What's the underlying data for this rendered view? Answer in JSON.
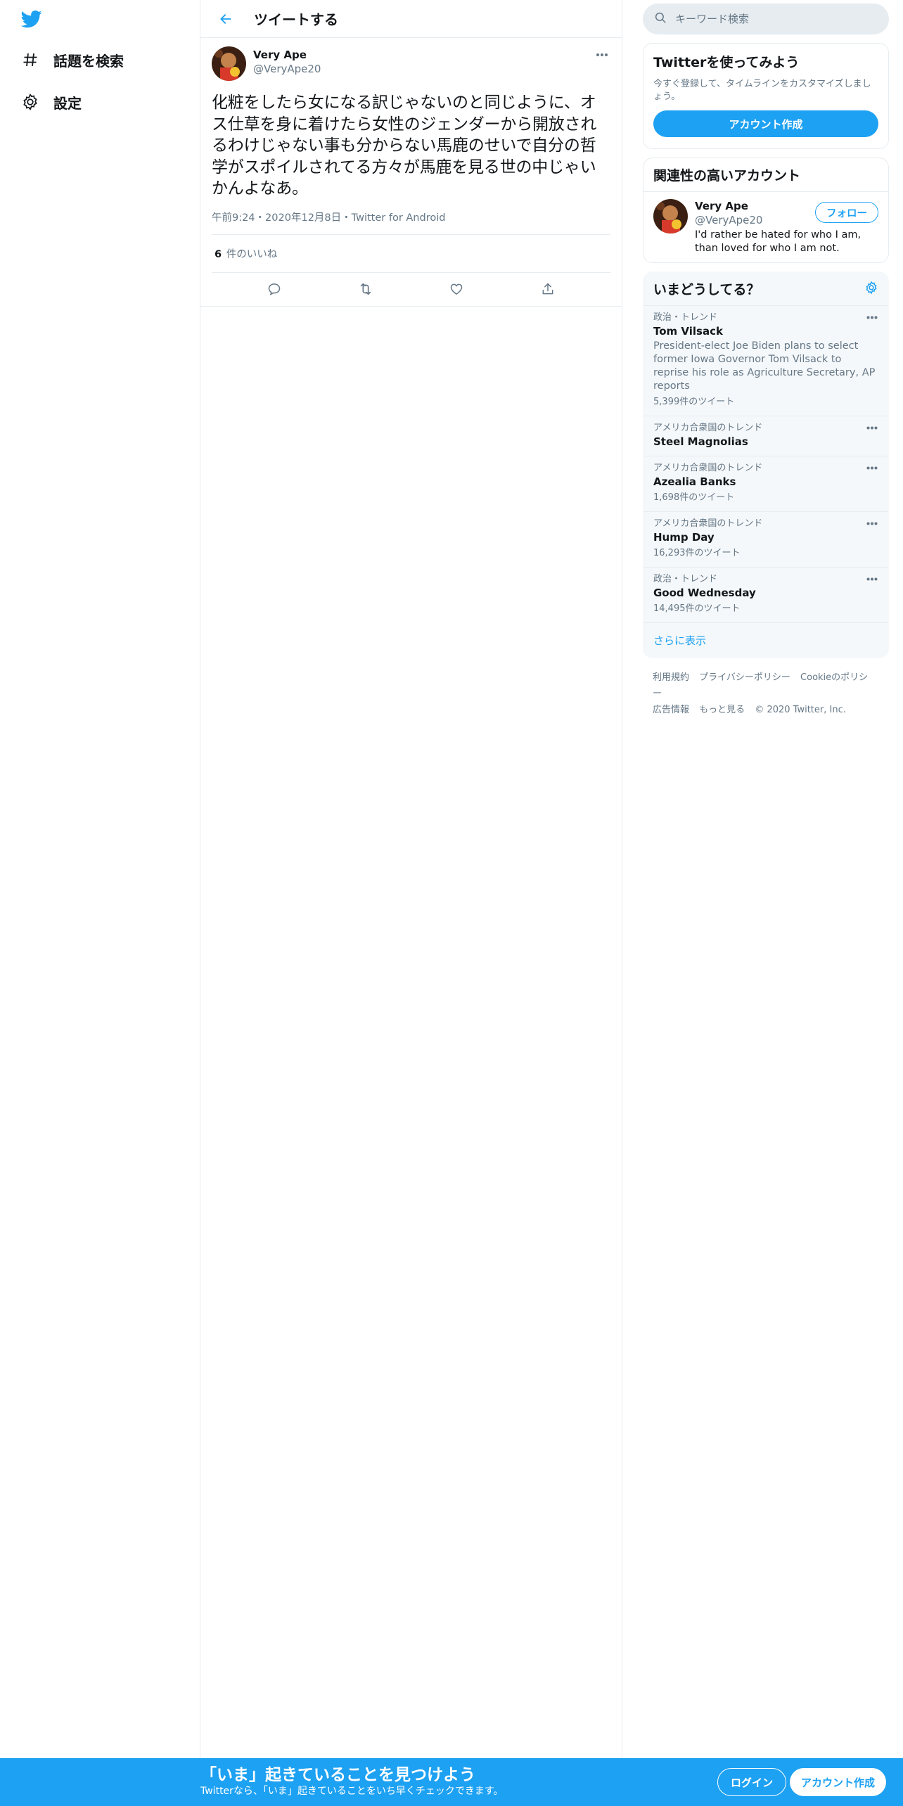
{
  "nav": {
    "logo": "twitter-bird-icon",
    "items": [
      {
        "label": "話題を検索",
        "icon": "hashtag-icon"
      },
      {
        "label": "設定",
        "icon": "gear-icon"
      }
    ]
  },
  "main": {
    "title": "ツイートする",
    "tweet": {
      "display_name": "Very Ape",
      "username": "@VeryApe20",
      "text": "化粧をしたら女になる訳じゃないのと同じように、オス仕草を身に着けたら女性のジェンダーから開放されるわけじゃない事も分からない馬鹿のせいで自分の哲学がスポイルされてる方々が馬鹿を見る世の中じゃいかんよなあ。",
      "meta": "午前9:24・2020年12月8日・Twitter for Android",
      "likes_count": "6",
      "likes_label": "件のいいね"
    }
  },
  "search": {
    "placeholder": "キーワード検索"
  },
  "signup_card": {
    "title": "Twitterを使ってみよう",
    "desc": "今すぐ登録して、タイムラインをカスタマイズしましょう。",
    "button": "アカウント作成"
  },
  "related": {
    "title": "関連性の高いアカウント",
    "display_name": "Very Ape",
    "username": "@VeryApe20",
    "bio": "I'd rather be hated for who I am, than loved for who I am not.",
    "follow": "フォロー"
  },
  "trends": {
    "title": "いまどうしてる？",
    "items": [
      {
        "context": "政治・トレンド",
        "name": "Tom Vilsack",
        "desc": "President-elect Joe Biden plans to select former Iowa Governor Tom Vilsack to reprise his role as Agriculture Secretary, AP reports",
        "count": "5,399件のツイート"
      },
      {
        "context": "アメリカ合衆国のトレンド",
        "name": "Steel Magnolias",
        "desc": "",
        "count": ""
      },
      {
        "context": "アメリカ合衆国のトレンド",
        "name": "Azealia Banks",
        "desc": "",
        "count": "1,698件のツイート"
      },
      {
        "context": "アメリカ合衆国のトレンド",
        "name": "Hump Day",
        "desc": "",
        "count": "16,293件のツイート"
      },
      {
        "context": "政治・トレンド",
        "name": "Good Wednesday",
        "desc": "",
        "count": "14,495件のツイート"
      }
    ],
    "show_more": "さらに表示"
  },
  "footer": {
    "links": [
      "利用規約",
      "プライバシーポリシー",
      "Cookieのポリシー",
      "広告情報",
      "もっと見る",
      "© 2020 Twitter, Inc."
    ]
  },
  "bottom_bar": {
    "title": "「いま」起きていることを見つけよう",
    "subtitle": "Twitterなら、「いま」起きていることをいち早くチェックできます。",
    "login": "ログイン",
    "signup": "アカウント作成"
  },
  "colors": {
    "accent": "#1da1f2",
    "text": "#14171a",
    "muted": "#657786",
    "border": "#e6ecf0"
  }
}
